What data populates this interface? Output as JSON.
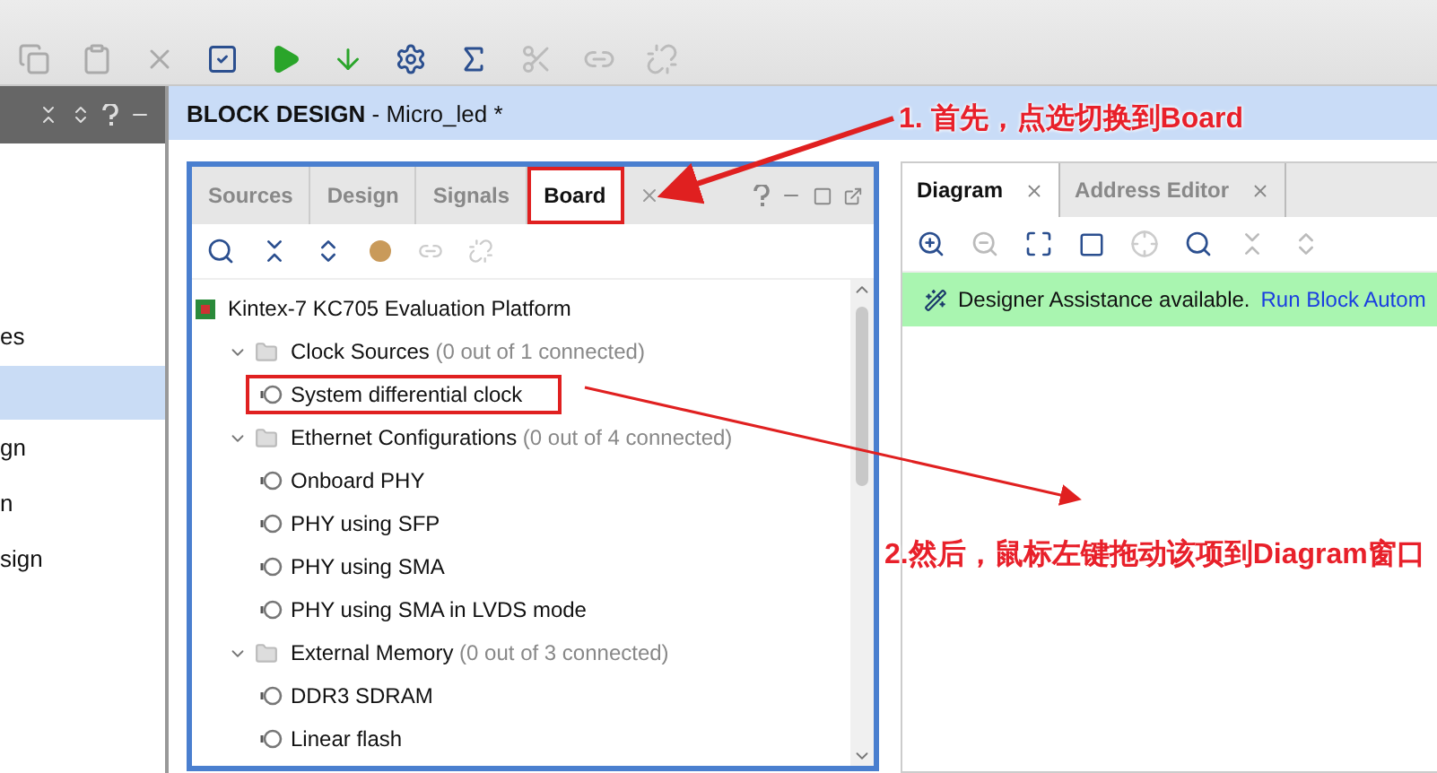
{
  "sidebar": {
    "items": [
      {
        "label": "es",
        "selected": false
      },
      {
        "selected": true
      },
      {
        "label": "gn",
        "selected": false
      },
      {
        "label": "n",
        "selected": false
      },
      {
        "label": "sign",
        "selected": false
      }
    ]
  },
  "editor": {
    "title": "**BLOCK DESIGN** - Micro_led *"
  },
  "board_panel": {
    "tabs": [
      {
        "label": "Sources",
        "selected": false,
        "highlighted": false
      },
      {
        "label": "Design",
        "selected": false,
        "highlighted": false
      },
      {
        "label": "Signals",
        "selected": false,
        "highlighted": false
      },
      {
        "label": "Board",
        "selected": true,
        "highlighted": true
      }
    ],
    "tree": {
      "label": "Kintex-7 KC705 Evaluation Platform",
      "children": [
        {
          "label": "Clock Sources",
          "note": "(0 out of 1 connected)",
          "expanded": true,
          "children": [
            {
              "label": "System differential clock",
              "highlighted": true
            }
          ]
        },
        {
          "label": "Ethernet Configurations",
          "note": "(0 out of 4 connected)",
          "expanded": true,
          "children": [
            {
              "label": "Onboard PHY",
              "highlighted": false
            },
            {
              "label": "PHY using SFP",
              "highlighted": false
            },
            {
              "label": "PHY using SMA",
              "highlighted": false
            },
            {
              "label": "PHY using SMA in LVDS mode",
              "highlighted": false
            }
          ]
        },
        {
          "label": "External Memory",
          "note": "(0 out of 3 connected)",
          "expanded": true,
          "children": [
            {
              "label": "DDR3 SDRAM",
              "highlighted": false
            },
            {
              "label": "Linear flash",
              "highlighted": false
            }
          ]
        }
      ]
    }
  },
  "diagram_panel": {
    "tabs": [
      {
        "label": "Diagram",
        "selected": true
      },
      {
        "label": "Address Editor",
        "selected": false
      }
    ],
    "banner": {
      "text": "Designer Assistance available.",
      "link": "Run Block Autom"
    }
  },
  "annotations": [
    {
      "text": "1. 首先，点选切换到Board"
    },
    {
      "text": "2.然后，鼠标左键拖动该项到Diagram窗口"
    }
  ]
}
